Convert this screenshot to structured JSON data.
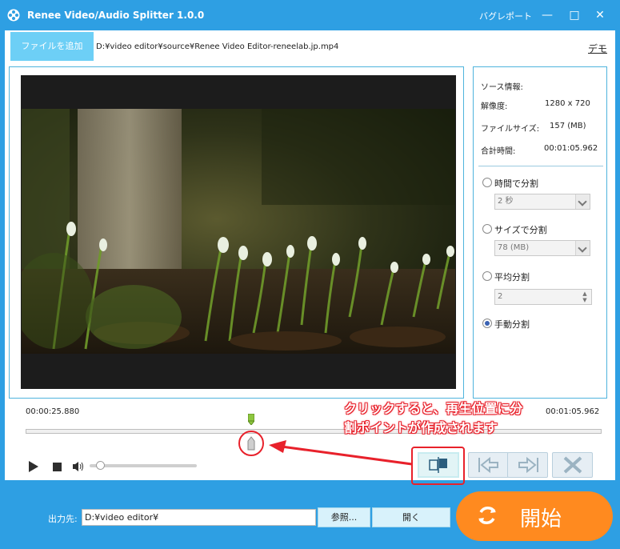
{
  "window": {
    "title": "Renee Video/Audio Splitter 1.0.0",
    "bug_report": "バグレポート",
    "minimize": "—",
    "maximize": "□",
    "close": "✕"
  },
  "toolbar": {
    "add_file": "ファイルを追加",
    "file_path": "D:¥video editor¥source¥Renee Video Editor-reneelab.jp.mp4",
    "demo": "デモ"
  },
  "info": {
    "heading": "ソース情報:",
    "resolution_label": "解像度:",
    "resolution_value": "1280 x 720",
    "size_label": "ファイルサイズ:",
    "size_value": "157 (MB)",
    "duration_label": "合計時間:",
    "duration_value": "00:01:05.962"
  },
  "split_options": {
    "by_time_label": "時間で分割",
    "by_time_value": "2 秒",
    "by_size_label": "サイズで分割",
    "by_size_value": "78 (MB)",
    "even_label": "平均分割",
    "even_value": "2",
    "manual_label": "手動分割",
    "selected": "manual"
  },
  "timeline": {
    "current_time": "00:00:25.880",
    "total_time": "00:01:05.962",
    "playhead_fraction": 0.392,
    "volume_fraction": 0.1
  },
  "annotation": {
    "line1": "クリックすると、再生位置に分",
    "line2": "割ポイントが作成されます"
  },
  "output": {
    "label": "出力先:",
    "path": "D:¥video editor¥",
    "browse": "参照...",
    "open": "開く",
    "start": "開始"
  },
  "colors": {
    "title_bar": "#2e9fe3",
    "panel_border": "#4fb4dd",
    "start_button": "#ff8a1f",
    "annotation_red": "#e8212b",
    "radio_selected": "#3a62b3"
  }
}
